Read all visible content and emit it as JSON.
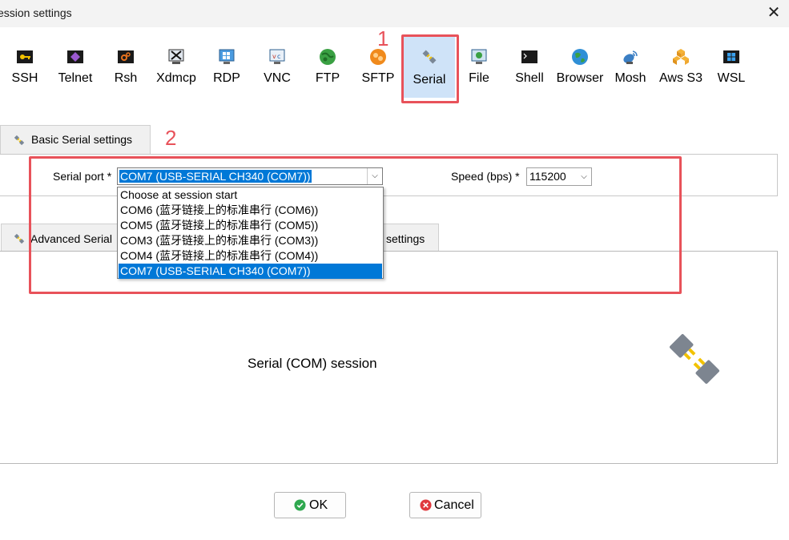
{
  "window": {
    "title": "ession settings"
  },
  "toolbar": {
    "items": [
      {
        "label": "SSH",
        "icon": "ssh-key-icon"
      },
      {
        "label": "Telnet",
        "icon": "telnet-icon"
      },
      {
        "label": "Rsh",
        "icon": "rsh-icon"
      },
      {
        "label": "Xdmcp",
        "icon": "xdmcp-icon"
      },
      {
        "label": "RDP",
        "icon": "rdp-monitor-icon"
      },
      {
        "label": "VNC",
        "icon": "vnc-icon"
      },
      {
        "label": "FTP",
        "icon": "ftp-globe-icon"
      },
      {
        "label": "SFTP",
        "icon": "sftp-icon"
      },
      {
        "label": "Serial",
        "icon": "serial-plug-icon",
        "selected": true
      },
      {
        "label": "File",
        "icon": "file-monitor-icon"
      },
      {
        "label": "Shell",
        "icon": "shell-terminal-icon"
      },
      {
        "label": "Browser",
        "icon": "browser-globe-icon"
      },
      {
        "label": "Mosh",
        "icon": "mosh-satellite-icon"
      },
      {
        "label": "Aws S3",
        "icon": "aws-s3-icon"
      },
      {
        "label": "WSL",
        "icon": "wsl-windows-icon"
      }
    ]
  },
  "annotations": {
    "marker1": "1",
    "marker2": "2"
  },
  "basic_tab": {
    "label": "Basic Serial settings"
  },
  "serial": {
    "port_label": "Serial port *",
    "port_value": "COM7  (USB-SERIAL CH340 (COM7))",
    "speed_label": "Speed (bps) *",
    "speed_value": "115200",
    "options": [
      "Choose at session start",
      "COM6  (蓝牙链接上的标准串行 (COM6))",
      "COM5  (蓝牙链接上的标准串行 (COM5))",
      "COM3  (蓝牙链接上的标准串行 (COM3))",
      "COM4  (蓝牙链接上的标准串行 (COM4))",
      "COM7  (USB-SERIAL CH340 (COM7))"
    ],
    "selected_index": 5
  },
  "advanced_tab": {
    "label": "Advanced Serial"
  },
  "other_tab": {
    "label": "settings"
  },
  "main": {
    "session_label": "Serial (COM) session"
  },
  "buttons": {
    "ok": "OK",
    "cancel": "Cancel"
  },
  "colors": {
    "accent": "#0078d7",
    "annotation": "#e8525a",
    "selected_tool": "#cfe3f8"
  }
}
